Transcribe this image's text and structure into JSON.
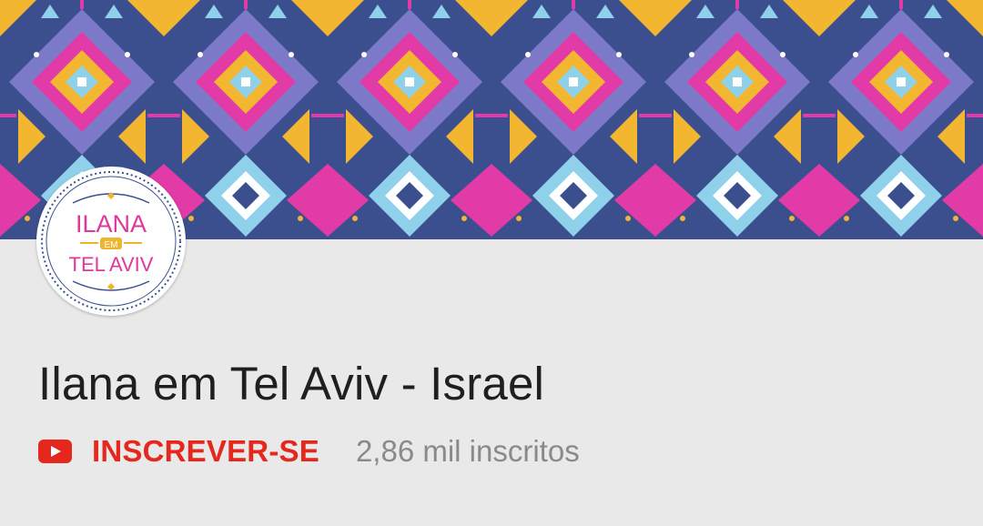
{
  "channel": {
    "banner_icon": "aztec-pattern-banner",
    "avatar_text_top": "ILANA",
    "avatar_text_middle": "EM",
    "avatar_text_bottom": "TEL AVIV",
    "title": "Ilana em Tel Aviv - Israel",
    "subscribe_label": "INSCREVER-SE",
    "subscriber_count": "2,86 mil inscritos"
  },
  "colors": {
    "background": "#e9e9e9",
    "subscribe_red": "#e5281e",
    "title_text": "#1f1f1f",
    "muted_text": "#8a8a8a",
    "banner_navy": "#3b4f8f",
    "banner_purple": "#7c79c9",
    "banner_pink": "#e23ba7",
    "banner_yellow": "#f2b630",
    "banner_light_blue": "#8fd0ea",
    "avatar_pink": "#e0379c",
    "avatar_gold": "#efb52e"
  }
}
